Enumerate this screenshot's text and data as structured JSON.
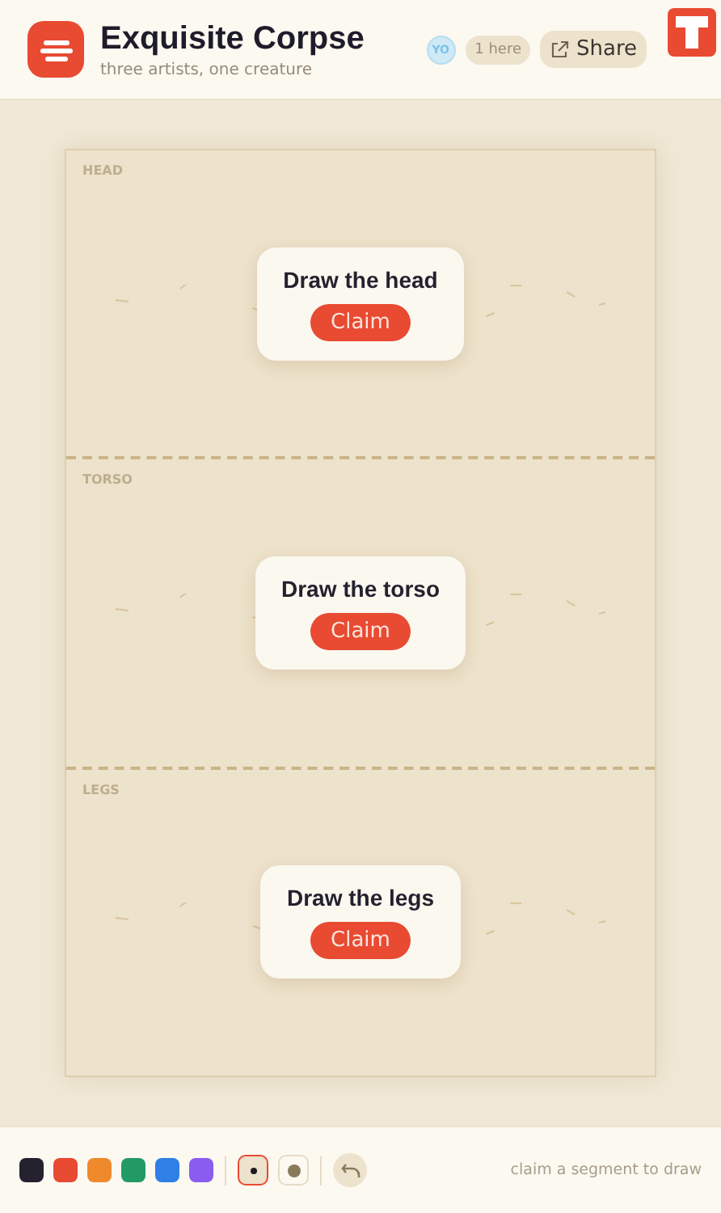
{
  "header": {
    "title": "Exquisite Corpse",
    "subtitle": "three artists, one creature",
    "avatar": "YO",
    "presence": "1 here",
    "share": "Share"
  },
  "segments": [
    {
      "label": "HEAD",
      "prompt": "Draw the head",
      "action": "Claim"
    },
    {
      "label": "TORSO",
      "prompt": "Draw the torso",
      "action": "Claim"
    },
    {
      "label": "LEGS",
      "prompt": "Draw the legs",
      "action": "Claim"
    }
  ],
  "colors": [
    {
      "color": "#24222e",
      "selected": false
    },
    {
      "color": "#e84a32",
      "selected": false
    },
    {
      "color": "#ef8a2c",
      "selected": false
    },
    {
      "color": "#229a66",
      "selected": false
    },
    {
      "color": "#2f7fe6",
      "selected": false
    },
    {
      "color": "#8b5cf0",
      "selected": false
    }
  ],
  "brushes": [
    {
      "kind": "small",
      "selected": true
    },
    {
      "kind": "large",
      "selected": false
    }
  ],
  "hint": "claim a segment to draw"
}
